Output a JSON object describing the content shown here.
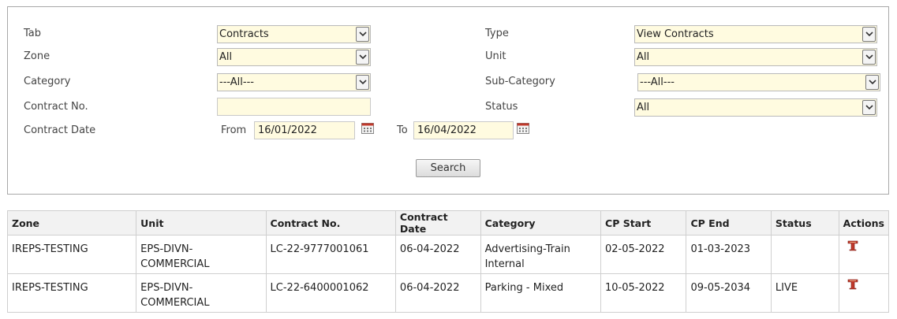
{
  "filters": {
    "tab": {
      "label": "Tab",
      "value": "Contracts"
    },
    "type": {
      "label": "Type",
      "value": "View Contracts"
    },
    "zone": {
      "label": "Zone",
      "value": "All"
    },
    "unit": {
      "label": "Unit",
      "value": "All"
    },
    "category": {
      "label": "Category",
      "value": "---All---"
    },
    "subcategory": {
      "label": "Sub-Category",
      "value": "---All---"
    },
    "contract_no": {
      "label": "Contract No.",
      "value": ""
    },
    "status": {
      "label": "Status",
      "value": "All"
    },
    "contract_date": {
      "label": "Contract Date",
      "from_label": "From",
      "from_value": "16/01/2022",
      "to_label": "To",
      "to_value": "16/04/2022"
    },
    "search_label": "Search"
  },
  "table": {
    "headers": [
      "Zone",
      "Unit",
      "Contract No.",
      "Contract Date",
      "Category",
      "CP Start",
      "CP End",
      "Status",
      "Actions"
    ],
    "rows": [
      {
        "zone": "IREPS-TESTING",
        "unit": "EPS-DIVN-\nCOMMERCIAL",
        "contract_no": "LC-22-9777001061",
        "contract_date": "06-04-2022",
        "category": "Advertising-Train\nInternal",
        "cp_start": "02-05-2022",
        "cp_end": "01-03-2023",
        "status": ""
      },
      {
        "zone": "IREPS-TESTING",
        "unit": "EPS-DIVN-\nCOMMERCIAL",
        "contract_no": "LC-22-6400001062",
        "contract_date": "06-04-2022",
        "category": "Parking - Mixed",
        "cp_start": "10-05-2022",
        "cp_end": "09-05-2034",
        "status": "LIVE"
      }
    ]
  },
  "icons": {
    "dropdown": "chevron-down-icon",
    "calendar": "calendar-icon",
    "action": "edit-t-icon"
  },
  "colors": {
    "field_bg": "#fffbe0",
    "action_icon": "#c0392b",
    "header_bg": "#f2f2f2"
  }
}
